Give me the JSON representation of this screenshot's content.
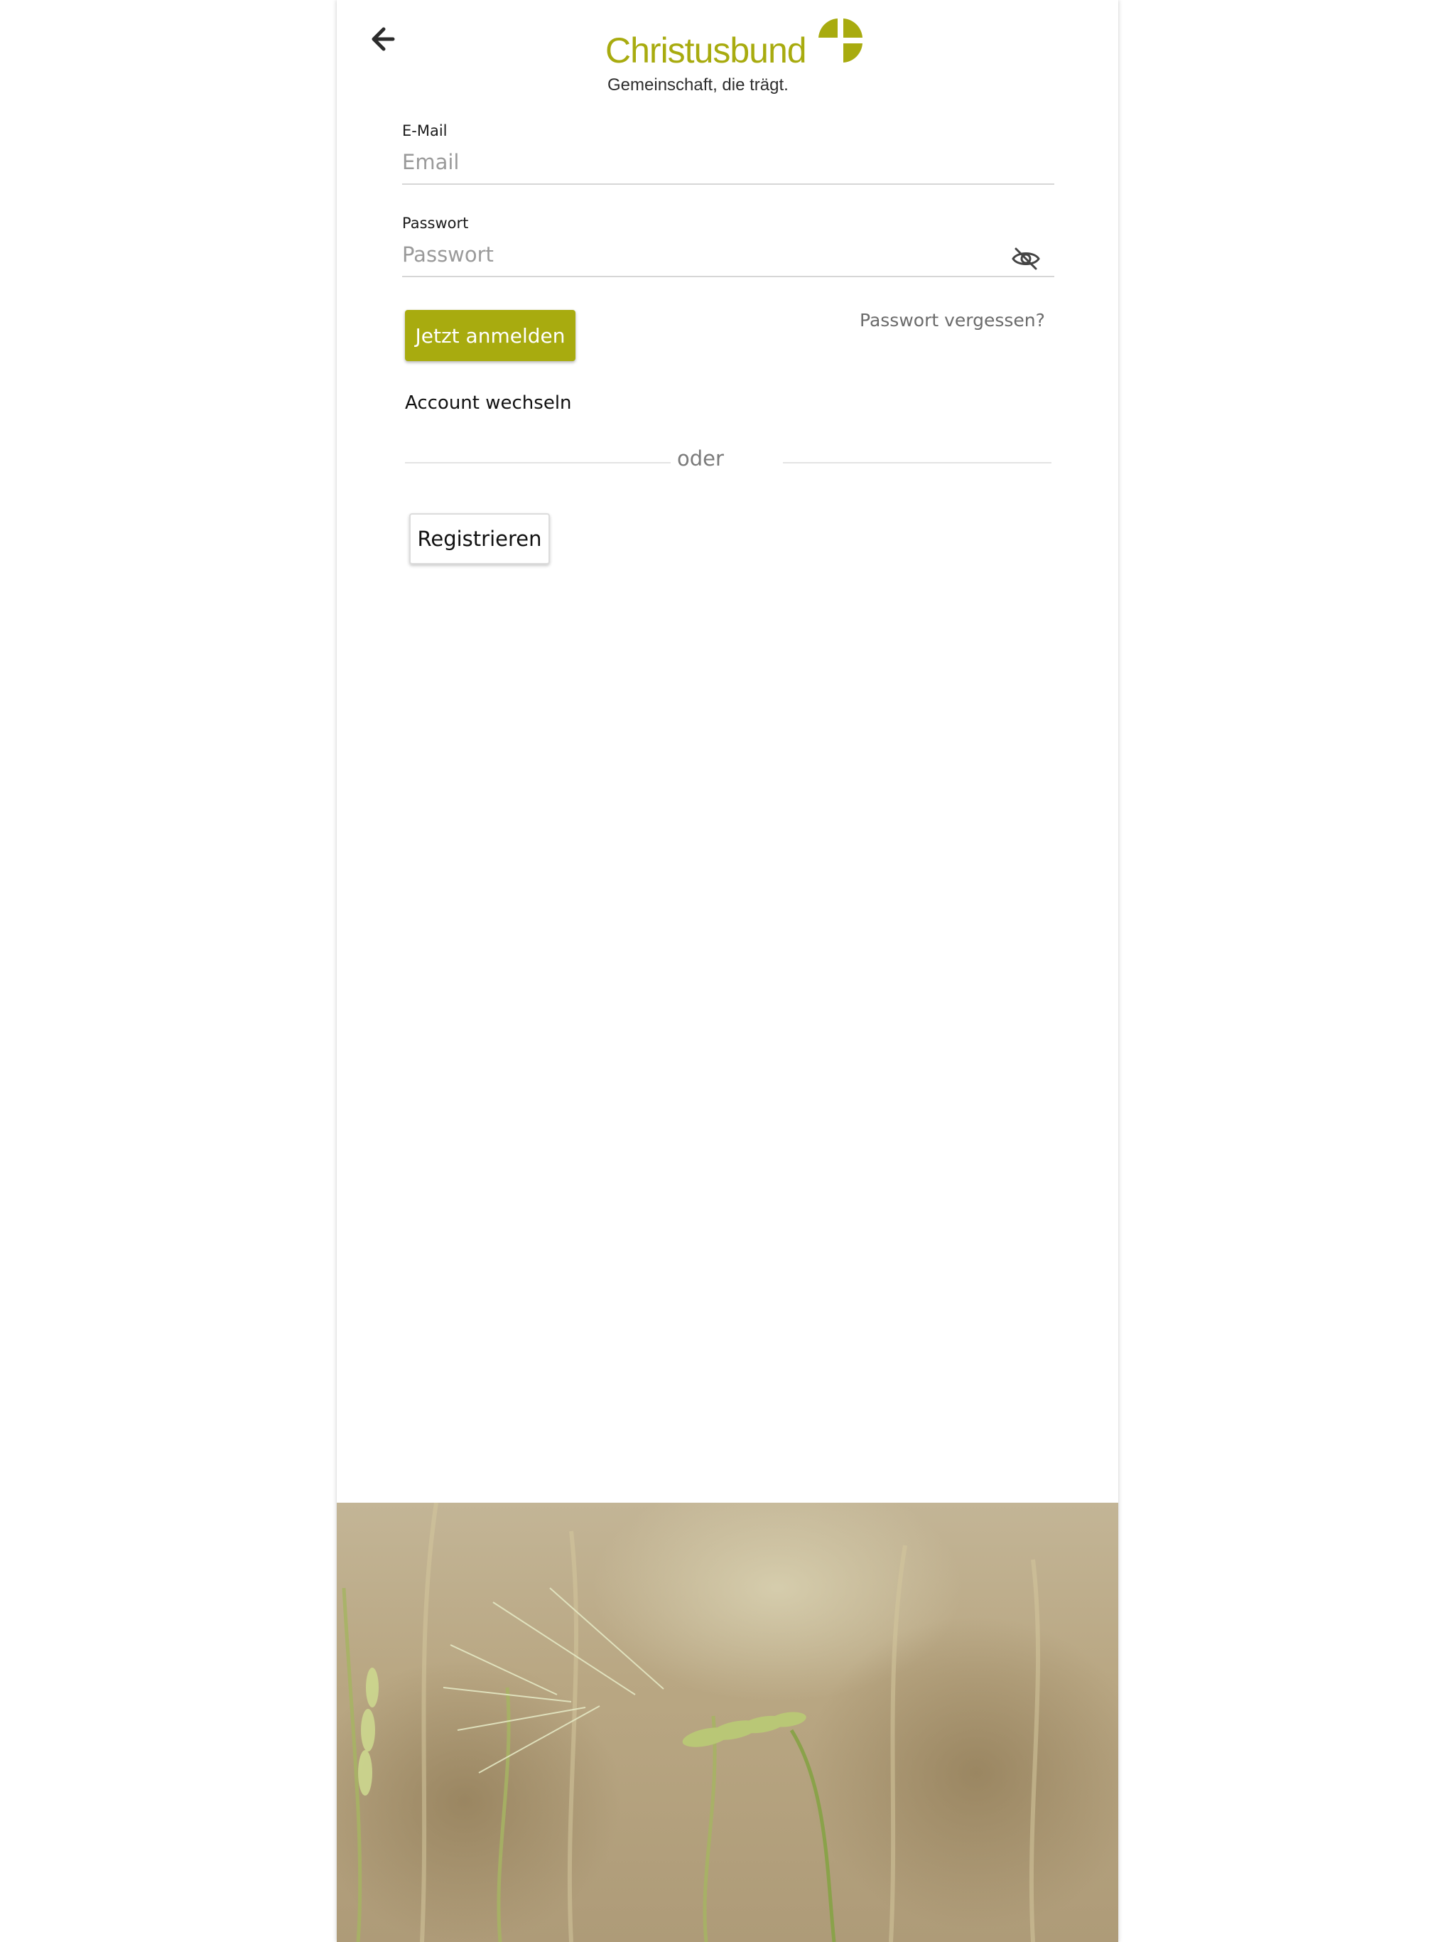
{
  "brand": {
    "name": "Christusbund",
    "tagline": "Gemeinschaft, die trägt.",
    "accent_color": "#a8ab0f"
  },
  "header": {
    "back_icon": "arrow-left-icon"
  },
  "form": {
    "email": {
      "label": "E-Mail",
      "placeholder": "Email",
      "value": ""
    },
    "password": {
      "label": "Passwort",
      "placeholder": "Passwort",
      "value": "",
      "toggle_icon": "eye-off-icon"
    },
    "login_label": "Jetzt anmelden",
    "forgot_label": "Passwort vergessen?",
    "switch_account_label": "Account wechseln",
    "divider_label": "oder",
    "register_label": "Registrieren"
  },
  "hero": {
    "subject": "wheat-field-photo"
  }
}
